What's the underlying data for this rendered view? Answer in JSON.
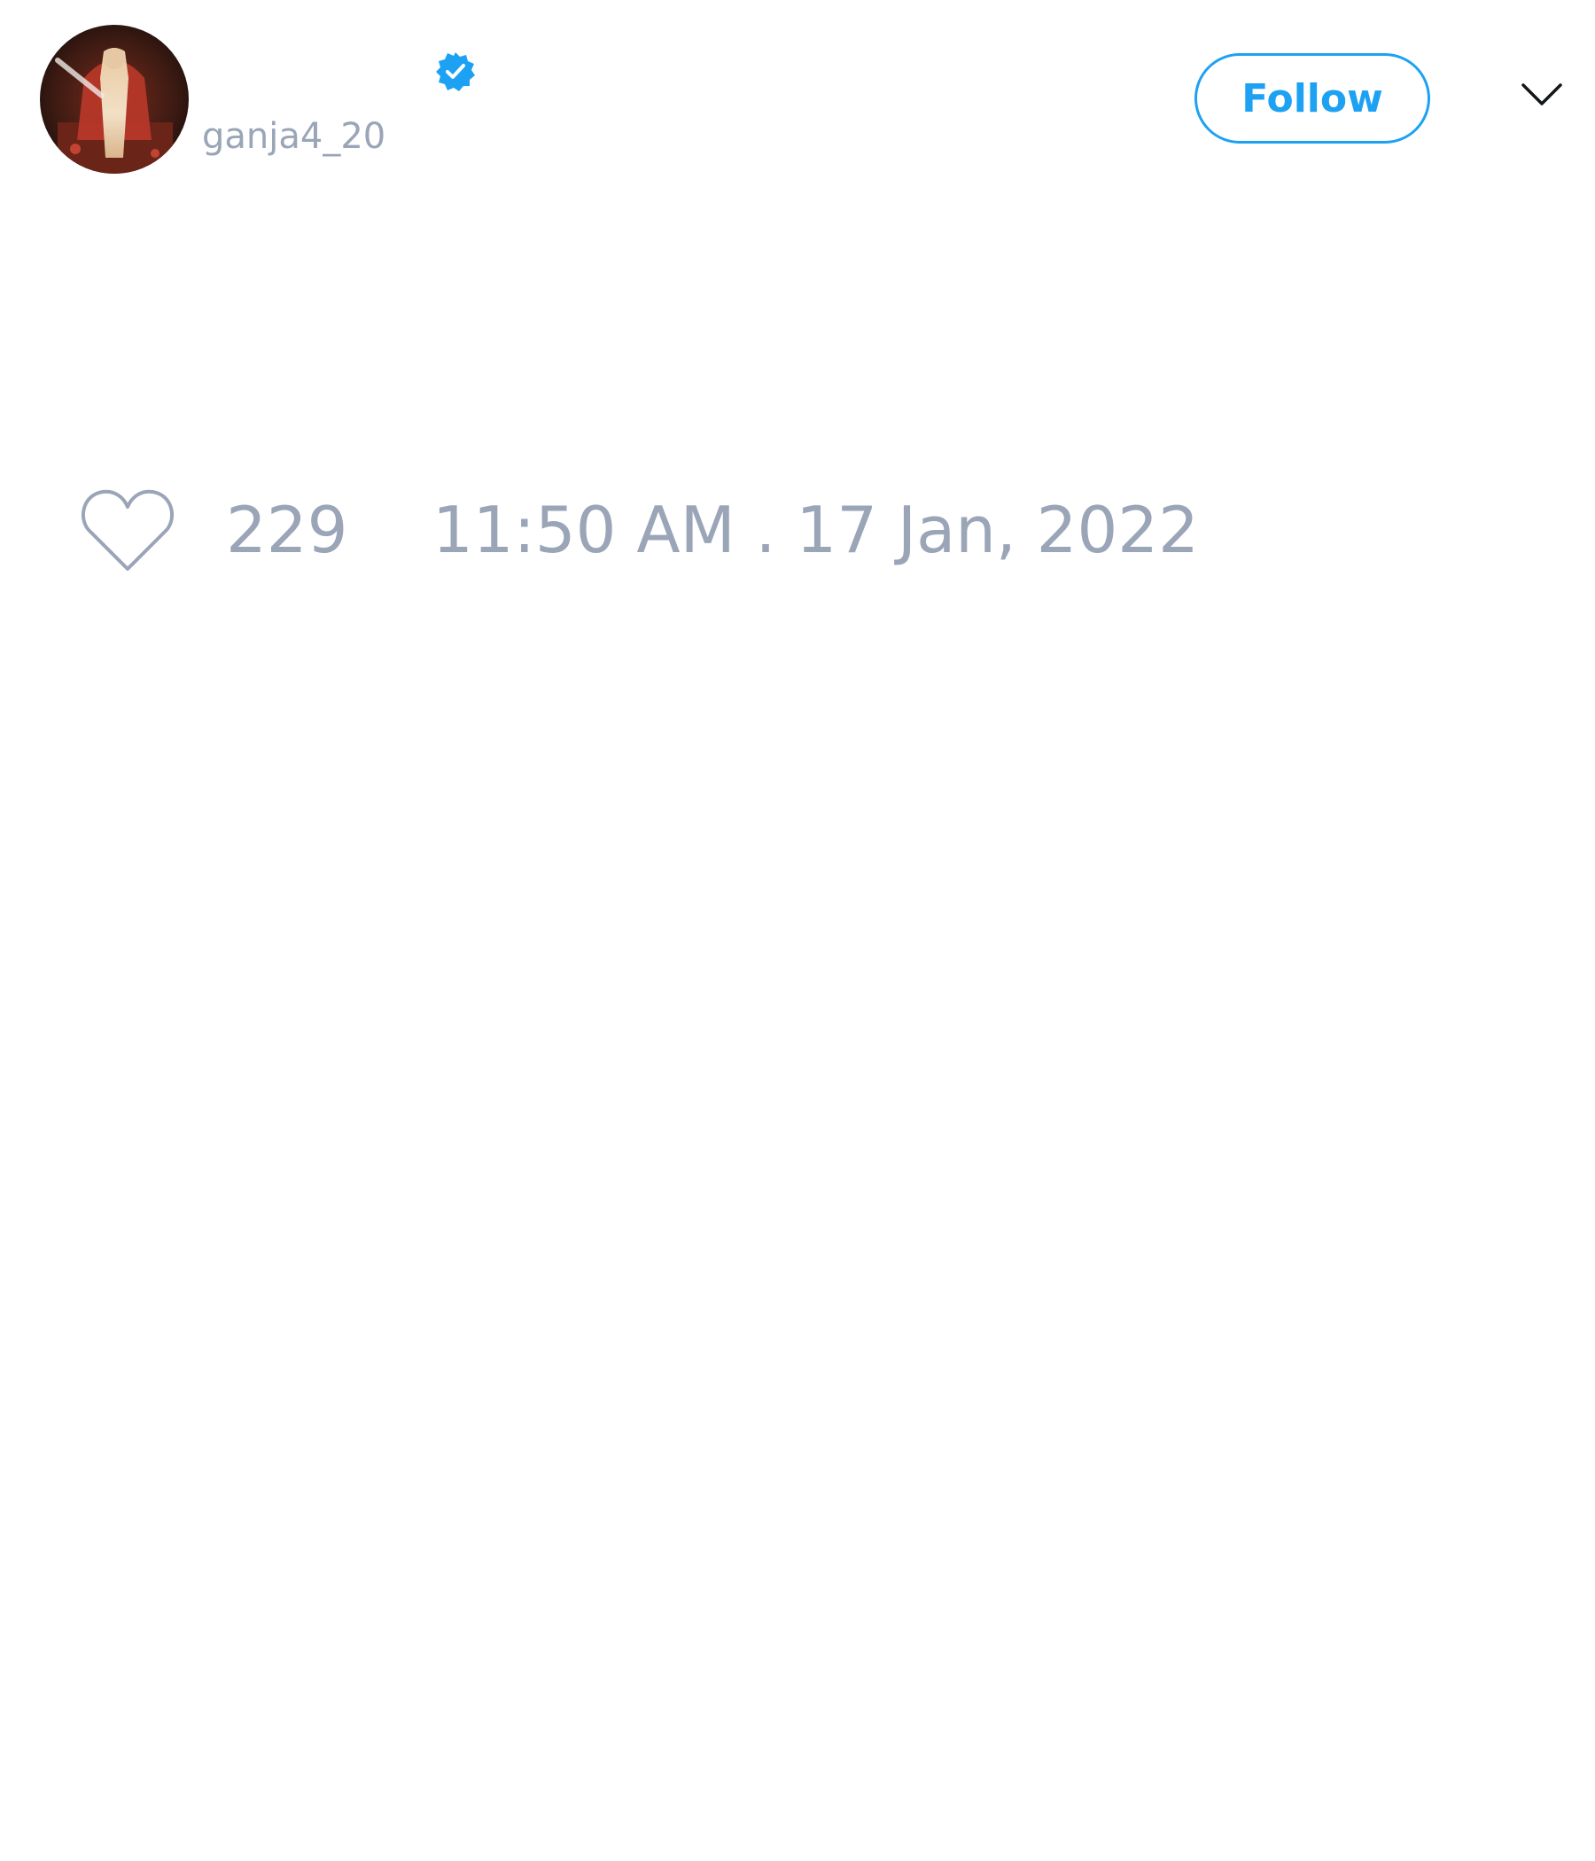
{
  "tweet": {
    "author": {
      "display_name": "",
      "handle": "ganja4_20",
      "verified": true,
      "avatar_icon": "avatar-image"
    },
    "follow_label": "Follow",
    "menu_icon": "chevron-down-icon",
    "like_icon": "heart-outline-icon",
    "like_count": "229",
    "timestamp": "11:50 AM . 17 Jan, 2022"
  },
  "colors": {
    "accent": "#1da1f2",
    "muted_text": "#9aa5b8",
    "background": "#ffffff"
  }
}
